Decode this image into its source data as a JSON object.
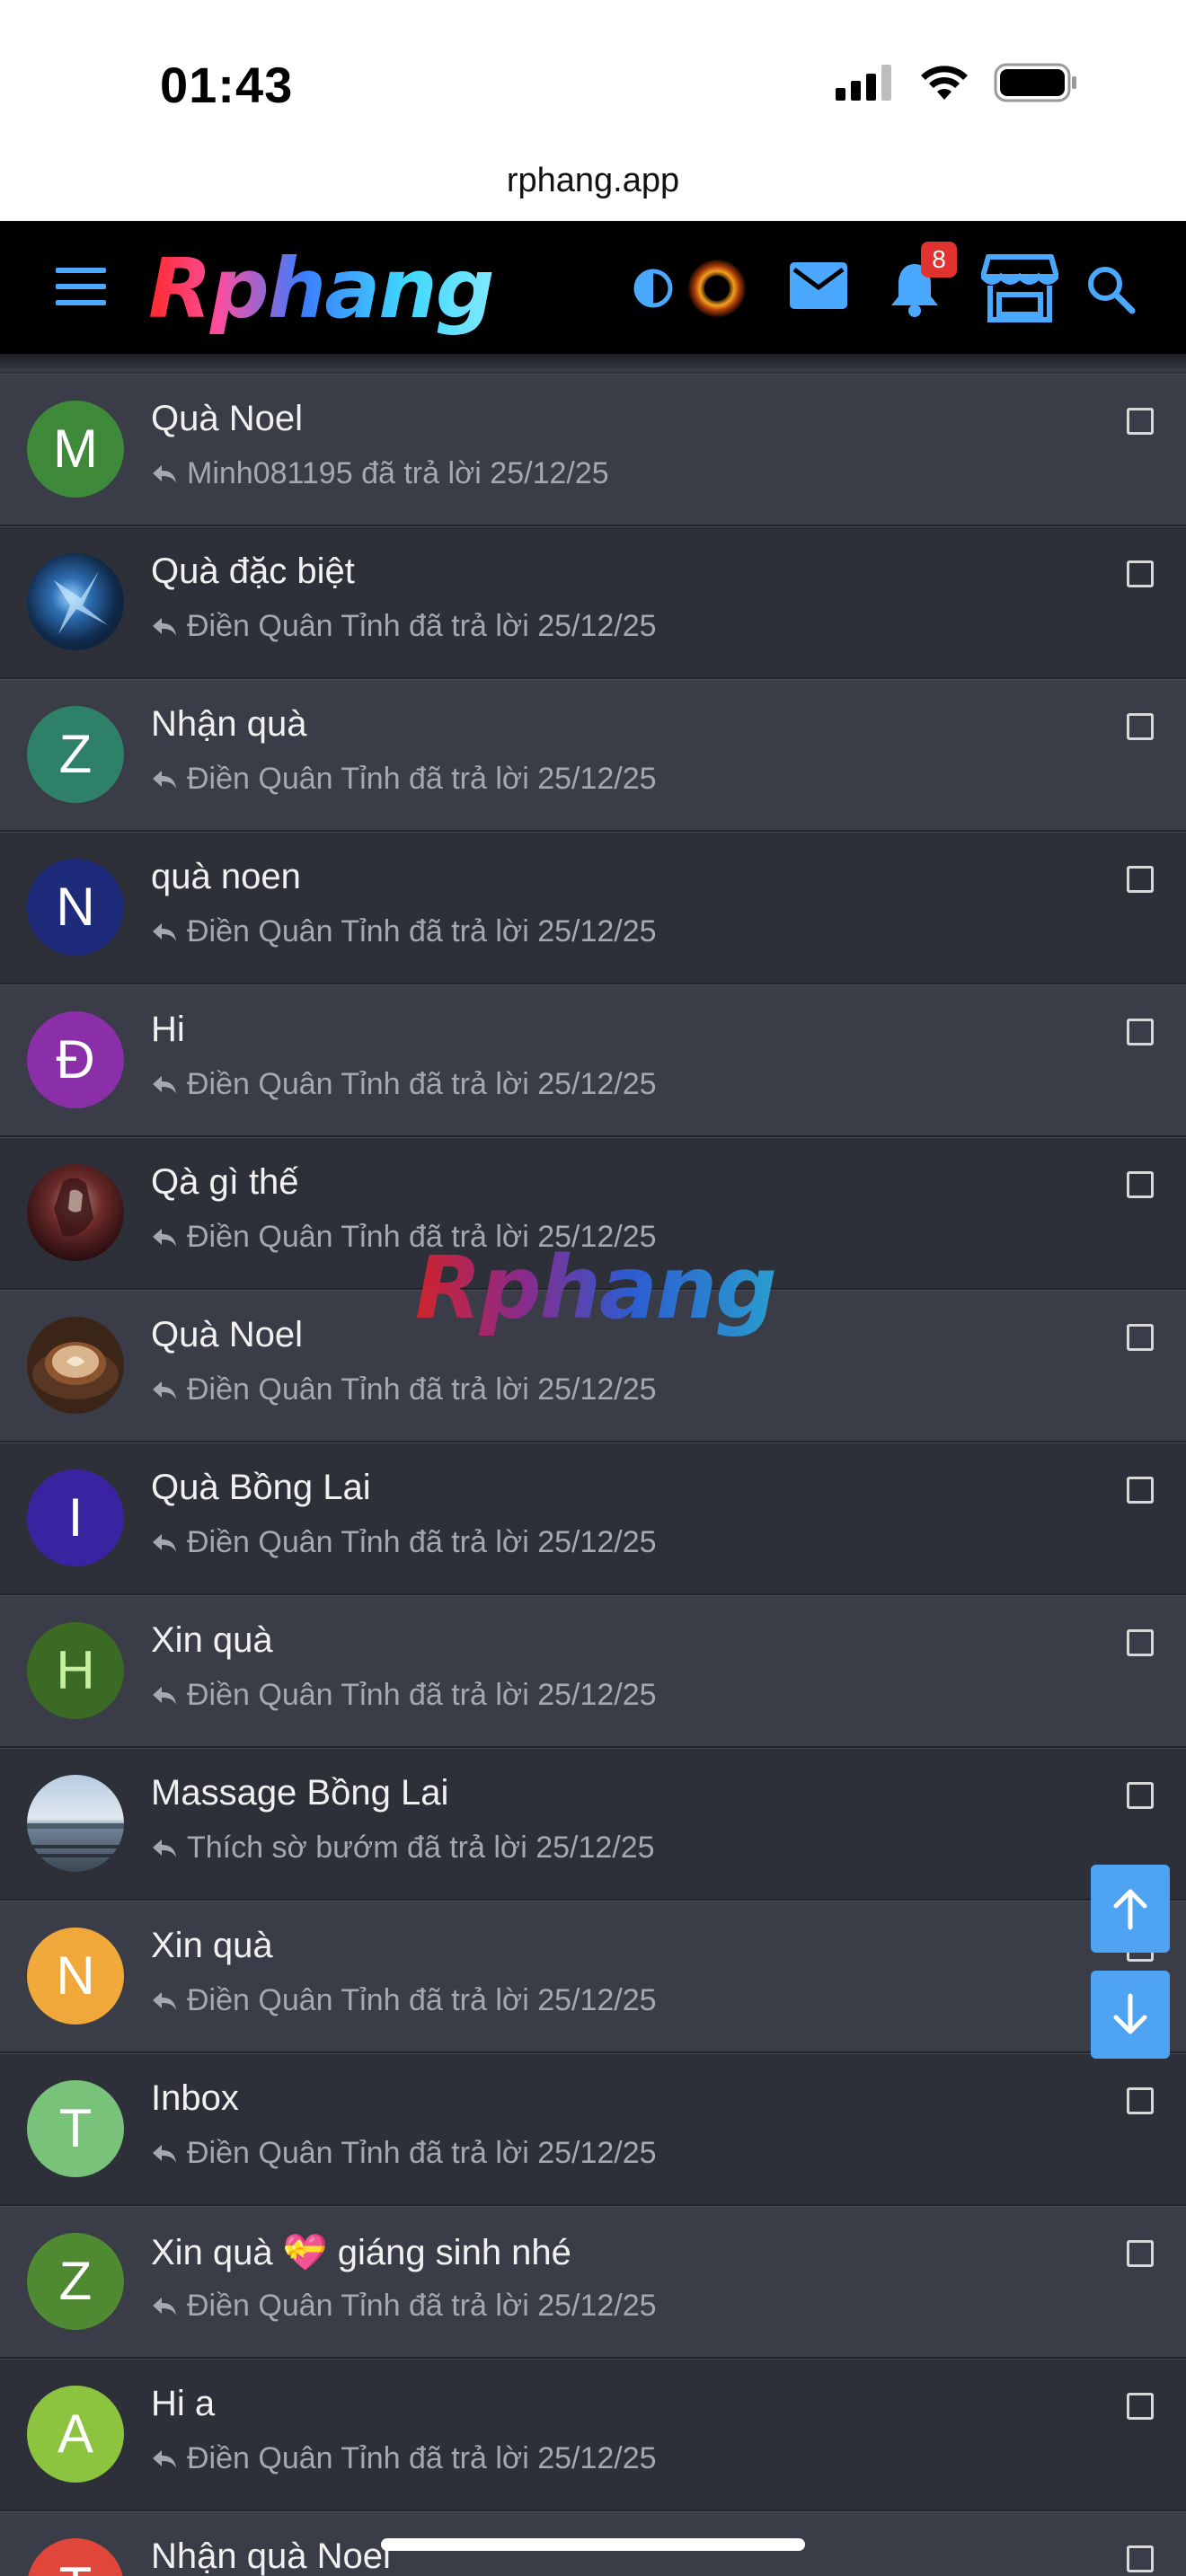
{
  "status_bar": {
    "time": "01:43"
  },
  "browser": {
    "url": "rphang.app"
  },
  "header": {
    "logo_text": "Rphang",
    "notification_count": "8",
    "accent_color": "#4aa8ff"
  },
  "watermark_text": "Rphang",
  "threads": [
    {
      "avatar_letter": "M",
      "avatar_color": "#3f8a3a",
      "title": "Quà Noel",
      "meta": "Minh081195 đã trả lời 25/12/25"
    },
    {
      "avatar_letter": "",
      "avatar_color": "#1d3f6e",
      "avatar_kind": "image-blue",
      "title": "Quà đặc biệt",
      "meta": "Điền Quân Tỉnh đã trả lời 25/12/25"
    },
    {
      "avatar_letter": "Z",
      "avatar_color": "#2e8068",
      "title": "Nhận quà",
      "meta": "Điền Quân Tỉnh đã trả lời 25/12/25"
    },
    {
      "avatar_letter": "N",
      "avatar_color": "#1e2a7a",
      "title": "quà noen",
      "meta": "Điền Quân Tỉnh đã trả lời 25/12/25"
    },
    {
      "avatar_letter": "Đ",
      "avatar_color": "#8a2fa8",
      "title": "Hi",
      "meta": "Điền Quân Tỉnh đã trả lời 25/12/25"
    },
    {
      "avatar_letter": "",
      "avatar_color": "#4a1f22",
      "avatar_kind": "image-dark",
      "title": "Qà gì thế",
      "meta": "Điền Quân Tỉnh đã trả lời 25/12/25"
    },
    {
      "avatar_letter": "",
      "avatar_color": "#8a5a34",
      "avatar_kind": "image-coffee",
      "title": "Quà Noel",
      "meta": "Điền Quân Tỉnh đã trả lời 25/12/25"
    },
    {
      "avatar_letter": "I",
      "avatar_color": "#3a23a0",
      "title": "Quà Bồng Lai",
      "meta": "Điền Quân Tỉnh đã trả lời 25/12/25"
    },
    {
      "avatar_letter": "H",
      "avatar_color": "#3a6a24",
      "title": "Xin quà",
      "meta": "Điền Quân Tỉnh đã trả lời 25/12/25"
    },
    {
      "avatar_letter": "",
      "avatar_color": "#7f97ad",
      "avatar_kind": "image-lake",
      "title": "Massage Bồng Lai",
      "meta": "Thích sờ bướm đã trả lời 25/12/25"
    },
    {
      "avatar_letter": "N",
      "avatar_color": "#f0a83a",
      "title": "Xin quà",
      "meta": "Điền Quân Tỉnh đã trả lời 25/12/25"
    },
    {
      "avatar_letter": "T",
      "avatar_color": "#78c27a",
      "title": "Inbox",
      "meta": "Điền Quân Tỉnh đã trả lời 25/12/25"
    },
    {
      "avatar_letter": "Z",
      "avatar_color": "#4f8a32",
      "title": "Xin quà 💝 giáng sinh nhé",
      "meta": "Điền Quân Tỉnh đã trả lời 25/12/25"
    },
    {
      "avatar_letter": "A",
      "avatar_color": "#8cc43f",
      "title": "Hi a",
      "meta": "Điền Quân Tỉnh đã trả lời 25/12/25"
    },
    {
      "avatar_letter": "T",
      "avatar_color": "#e0473a",
      "title": "Nhận quà Noel",
      "meta": ""
    }
  ]
}
